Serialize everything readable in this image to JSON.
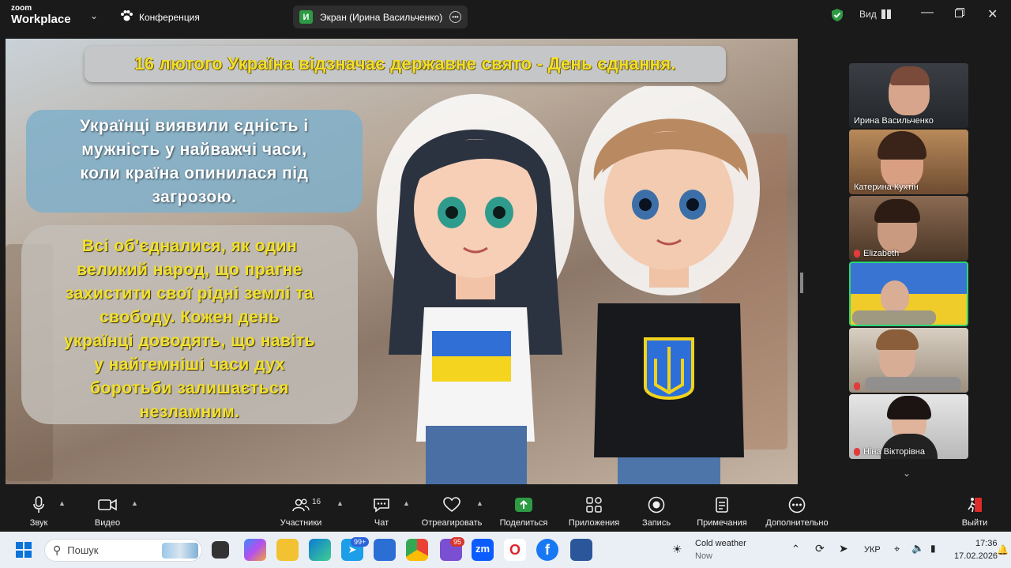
{
  "app": {
    "brand_small": "zoom",
    "brand_big": "Workplace",
    "conference_label": "Конференция"
  },
  "screen_share": {
    "avatar_letter": "И",
    "label": "Экран (Ирина Васильченко)"
  },
  "top_right": {
    "view_label": "Вид"
  },
  "slide": {
    "title": "16 лютого Україна відзначає державне свято - День єднання.",
    "bubble1_lines": [
      "Українці виявили єдність і",
      "мужність у найважчі часи,",
      "коли країна опинилася під",
      "загрозою."
    ],
    "bubble2_lines": [
      "Всі об'єдналися, як один",
      "великий народ, що прагне",
      "захистити свої рідні землі та",
      "свободу. Кожен день",
      "українці доводять, що навіть",
      "у найтемніші часи дух",
      "боротьби залишається",
      "незламним."
    ]
  },
  "participants": [
    {
      "name": "Ирина Васильченко",
      "muted": false
    },
    {
      "name": "Катерина Кухтін",
      "muted": false
    },
    {
      "name": "Elizabeth",
      "muted": true
    },
    {
      "name": "",
      "muted": false
    },
    {
      "name": "",
      "muted": true
    },
    {
      "name": "Ніна Вікторівна",
      "muted": true
    }
  ],
  "toolbar": {
    "audio": "Звук",
    "video": "Видео",
    "participants": "Участники",
    "participants_count": "16",
    "chat": "Чат",
    "react": "Отреагировать",
    "share": "Поделиться",
    "apps": "Приложения",
    "record": "Запись",
    "notes": "Примечания",
    "more": "Дополнительно",
    "leave": "Выйти"
  },
  "taskbar": {
    "search_placeholder": "Пошук",
    "badge_a": "99+",
    "badge_b": "95",
    "weather_title": "Cold weather",
    "weather_sub": "Now",
    "lang": "УКР",
    "time": "17:36",
    "date": "17.02.2026"
  },
  "colors": {
    "accent_green": "#2e9a44",
    "slide_yellow": "#f1de2c",
    "zoom_blue": "#0b5cff",
    "active_tile_border": "#2ed573"
  }
}
